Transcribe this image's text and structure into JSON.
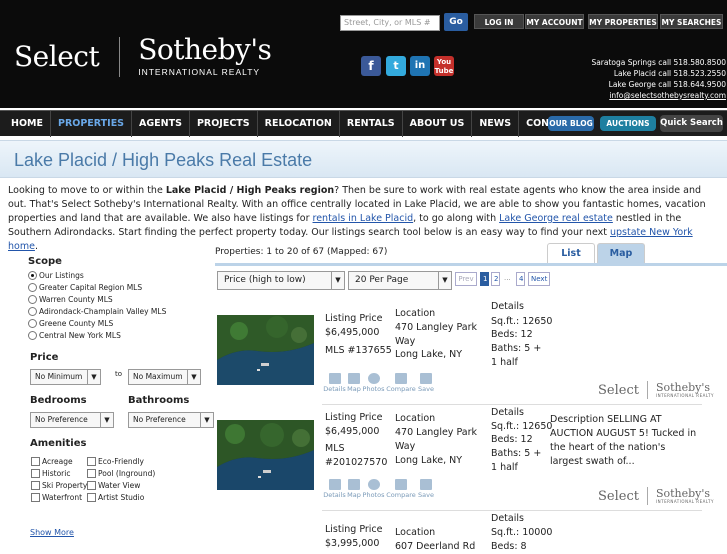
{
  "header": {
    "logo_select": "Select",
    "logo_sothebys": "Sotheby's",
    "logo_sub": "INTERNATIONAL REALTY",
    "search_placeholder": "Street, City, or MLS #",
    "go": "Go",
    "top_nav": [
      "LOG IN",
      "MY ACCOUNT",
      "MY PROPERTIES",
      "MY SEARCHES"
    ],
    "social": [
      "facebook-icon",
      "twitter-icon",
      "linkedin-icon",
      "youtube-icon"
    ],
    "phones": [
      "Saratoga Springs call 518.580.8500",
      "Lake Placid call 518.523.2550",
      "Lake George call 518.644.9500",
      "info@selectsothebysrealty.com"
    ]
  },
  "main_nav": [
    "HOME",
    "PROPERTIES",
    "AGENTS",
    "PROJECTS",
    "RELOCATION",
    "RENTALS",
    "ABOUT US",
    "NEWS",
    "CONTACT US"
  ],
  "nav_pills": {
    "blog": "OUR BLOG",
    "auctions": "AUCTIONS",
    "quick": "Quick Search"
  },
  "page_title": "Lake Placid / High Peaks Real Estate",
  "intro": {
    "p1": "Looking to move to or within the ",
    "bold": "Lake Placid / High Peaks region",
    "p2": "? Then be sure to work with real estate agents who know the area inside and out. That's Select Sotheby's International Realty. With an office centrally located in Lake Placid, we are able to show you fantastic homes, vacation properties and land that are available. We also have listings for ",
    "link1": "rentals in Lake Placid",
    "p3": ", to go along with ",
    "link2": "Lake George real estate",
    "p4": " nestled in the Southern Adirondacks. Start finding the perfect property today. Our listings search tool below is an easy way to find your next ",
    "link3": "upstate New York home",
    "p5": "."
  },
  "sidebar": {
    "scope_label": "Scope",
    "scope_options": [
      "Our Listings",
      "Greater Capital Region MLS",
      "Warren County MLS",
      "Adirondack-Champlain Valley MLS",
      "Greene County MLS",
      "Central New York MLS"
    ],
    "price_label": "Price",
    "price_min": "No Minimum",
    "price_to": "to",
    "price_max": "No Maximum",
    "bed_label": "Bedrooms",
    "bath_label": "Bathrooms",
    "bed_value": "No Preference",
    "bath_value": "No Preference",
    "amenities_label": "Amenities",
    "amenities": [
      "Acreage",
      "Eco-Friendly",
      "Historic",
      "Pool (Inground)",
      "Ski Property",
      "Water View",
      "Waterfront",
      "Artist Studio"
    ],
    "show_more": "Show More"
  },
  "results": {
    "count_text": "Properties: 1 to 20 of 67 (Mapped: 67)",
    "tab_list": "List",
    "tab_map": "Map",
    "sort": "Price (high to low)",
    "per_page": "20 Per Page",
    "pager": [
      "Prev",
      "1",
      "2",
      "...",
      "4",
      "Next"
    ]
  },
  "listing_labels": {
    "price": "Listing Price",
    "location": "Location",
    "details": "Details",
    "icon_labels": [
      "Details",
      "Map",
      "Photos",
      "Compare",
      "Save"
    ],
    "brand_select": "Select",
    "brand_sothebys": "Sotheby's",
    "brand_sub": "INTERNATIONAL REALTY"
  },
  "listings": [
    {
      "price": "$6,495,000",
      "mls": "MLS #137655",
      "street": "470 Langley Park Way",
      "city": "Long Lake, NY",
      "sqft": "Sq.ft.: 12650",
      "beds": "Beds: 12",
      "baths": "Baths: 5 + 1 half",
      "desc": ""
    },
    {
      "price": "$6,495,000",
      "mls": "MLS #201027570",
      "street": "470 Langley Park Way",
      "city": "Long Lake, NY",
      "sqft": "Sq.ft.: 12650",
      "beds": "Beds: 12",
      "baths": "Baths: 5 + 1 half",
      "desc": "Description SELLING AT AUCTION AUGUST 5! Tucked in the heart of the nation's largest swath of..."
    },
    {
      "price": "$3,995,000",
      "street": "607 Deerland Rd",
      "sqft": "Sq.ft.: 10000",
      "beds": "Beds: 8"
    }
  ]
}
